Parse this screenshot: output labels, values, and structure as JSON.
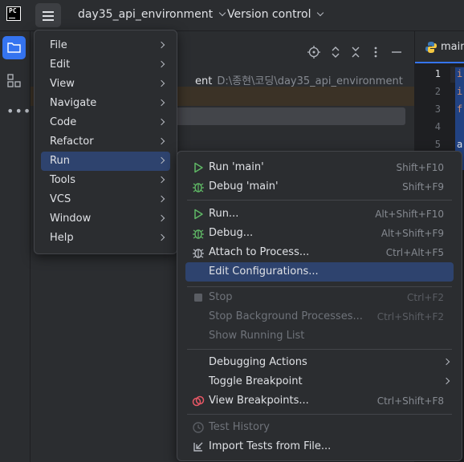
{
  "titlebar": {
    "logo_text": "PC",
    "project_name": "day35_api_environment",
    "vcs_label": "Version control"
  },
  "project_pane": {
    "root_name_fragment": "ent",
    "root_path": "D:\\종현\\코딩\\day35_api_environment"
  },
  "editor": {
    "tab_label": "main",
    "line_numbers": [
      "1",
      "2",
      "3",
      "4",
      "5"
    ],
    "code_chars": [
      "i",
      "i",
      "f",
      "",
      "a"
    ]
  },
  "main_menu": {
    "items": [
      {
        "label": "File"
      },
      {
        "label": "Edit"
      },
      {
        "label": "View"
      },
      {
        "label": "Navigate"
      },
      {
        "label": "Code"
      },
      {
        "label": "Refactor"
      },
      {
        "label": "Run"
      },
      {
        "label": "Tools"
      },
      {
        "label": "VCS"
      },
      {
        "label": "Window"
      },
      {
        "label": "Help"
      }
    ],
    "selected": "Run"
  },
  "run_menu": {
    "items": [
      {
        "label": "Run 'main'",
        "shortcut": "Shift+F10",
        "icon": "run-icon"
      },
      {
        "label": "Debug 'main'",
        "shortcut": "Shift+F9",
        "icon": "debug-icon"
      },
      {
        "label": "Run...",
        "shortcut": "Alt+Shift+F10",
        "icon": "run-icon"
      },
      {
        "label": "Debug...",
        "shortcut": "Alt+Shift+F9",
        "icon": "debug-icon"
      },
      {
        "label": "Attach to Process...",
        "shortcut": "Ctrl+Alt+F5",
        "icon": "attach-debugger-icon"
      },
      {
        "label": "Edit Configurations...",
        "shortcut": "",
        "icon": ""
      },
      {
        "label": "Stop",
        "shortcut": "Ctrl+F2",
        "icon": "stop-icon",
        "disabled": true
      },
      {
        "label": "Stop Background Processes...",
        "shortcut": "Ctrl+Shift+F2",
        "disabled": true
      },
      {
        "label": "Show Running List",
        "shortcut": "",
        "disabled": true
      },
      {
        "label": "Debugging Actions",
        "shortcut": "",
        "submenu": true
      },
      {
        "label": "Toggle Breakpoint",
        "shortcut": "",
        "submenu": true
      },
      {
        "label": "View Breakpoints...",
        "shortcut": "Ctrl+Shift+F8",
        "icon": "breakpoints-icon"
      },
      {
        "label": "Test History",
        "shortcut": "",
        "icon": "history-icon",
        "disabled": true
      },
      {
        "label": "Import Tests from File...",
        "shortcut": "",
        "icon": "import-icon"
      }
    ],
    "selected": "Edit Configurations..."
  },
  "colors": {
    "accent": "#3574f0",
    "selection": "#2e436e",
    "run_green": "#5fb865",
    "breakpoint_red": "#e55765",
    "python_blue": "#3d7ab8",
    "python_yellow": "#f5c842"
  }
}
